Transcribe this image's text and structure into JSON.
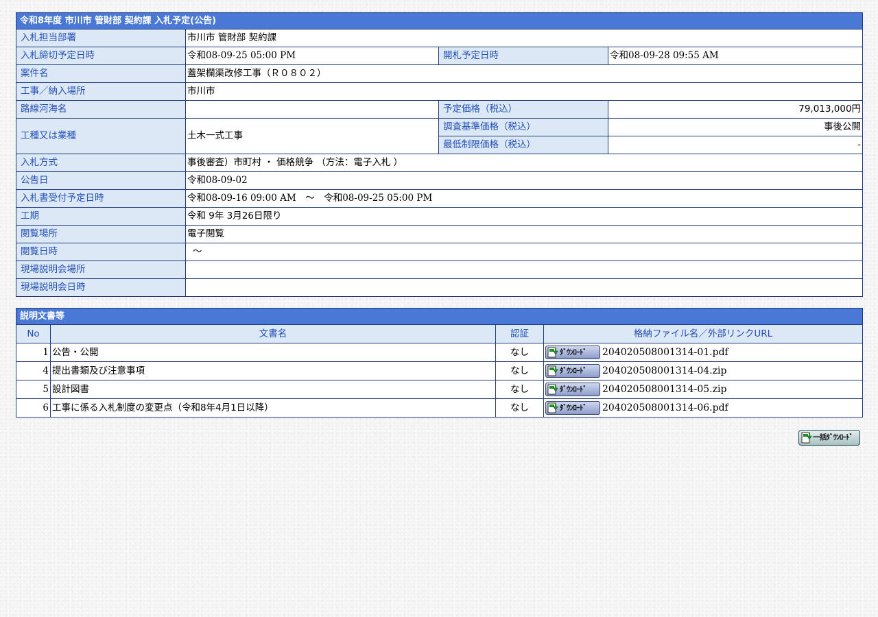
{
  "notice": {
    "title": "令和8年度 市川市 管財部 契約課 入札予定(公告)",
    "rows": {
      "dept_label": "入札担当部署",
      "dept_value": "市川市 管財部 契約課",
      "deadline_label": "入札締切予定日時",
      "deadline_value": "令和08-09-25 05:00 PM",
      "opening_label": "開札予定日時",
      "opening_value": "令和08-09-28 09:55 AM",
      "case_label": "案件名",
      "case_value": "蓋架欄渠改修工事（Ｒ０８０２）",
      "place_label": "工事／納入場所",
      "place_value": "市川市",
      "route_label": "路線河海名",
      "route_value": "",
      "planned_price_label": "予定価格（税込）",
      "planned_price_value": "79,013,000円",
      "work_type_label": "工種又は業種",
      "work_type_value": "土木一式工事",
      "survey_price_label": "調査基準価格（税込）",
      "survey_price_value": "事後公開",
      "min_price_label": "最低制限価格（税込）",
      "min_price_value": "-",
      "method_label": "入札方式",
      "method_value": "事後審査）市町村 ・ 価格競争 （方法：電子入札 ）",
      "announce_label": "公告日",
      "announce_value": "令和08-09-02",
      "reception_label": "入札書受付予定日時",
      "reception_value": "令和08-09-16 09:00 AM　～　令和08-09-25 05:00 PM",
      "period_label": "工期",
      "period_value": "令和 9年 3月26日限り",
      "view_place_label": "閲覧場所",
      "view_place_value": "電子閲覧",
      "view_date_label": "閲覧日時",
      "view_date_value": "～",
      "site_place_label": "現場説明会場所",
      "site_place_value": "",
      "site_date_label": "現場説明会日時",
      "site_date_value": ""
    }
  },
  "documents": {
    "title": "説明文書等",
    "headers": {
      "no": "No",
      "name": "文書名",
      "auth": "認証",
      "file": "格納ファイル名／外部リンクURL"
    },
    "download_label": "ﾀﾞｳﾝﾛｰﾄﾞ",
    "items": [
      {
        "no": "1",
        "name": "公告・公開",
        "auth": "なし",
        "file": "204020508001314-01.pdf"
      },
      {
        "no": "4",
        "name": "提出書類及び注意事項",
        "auth": "なし",
        "file": "204020508001314-04.zip"
      },
      {
        "no": "5",
        "name": "設計図書",
        "auth": "なし",
        "file": "204020508001314-05.zip"
      },
      {
        "no": "6",
        "name": "工事に係る入札制度の変更点（令和8年4月1日以降）",
        "auth": "なし",
        "file": "204020508001314-06.pdf"
      }
    ]
  },
  "bulk_download_label": "一括ﾀﾞｳﾝﾛｰﾄﾞ",
  "colors": {
    "title_bar": "#4a78d6",
    "label_bg": "#dce8f6",
    "label_text": "#2350b5",
    "border": "#1f3a78"
  }
}
